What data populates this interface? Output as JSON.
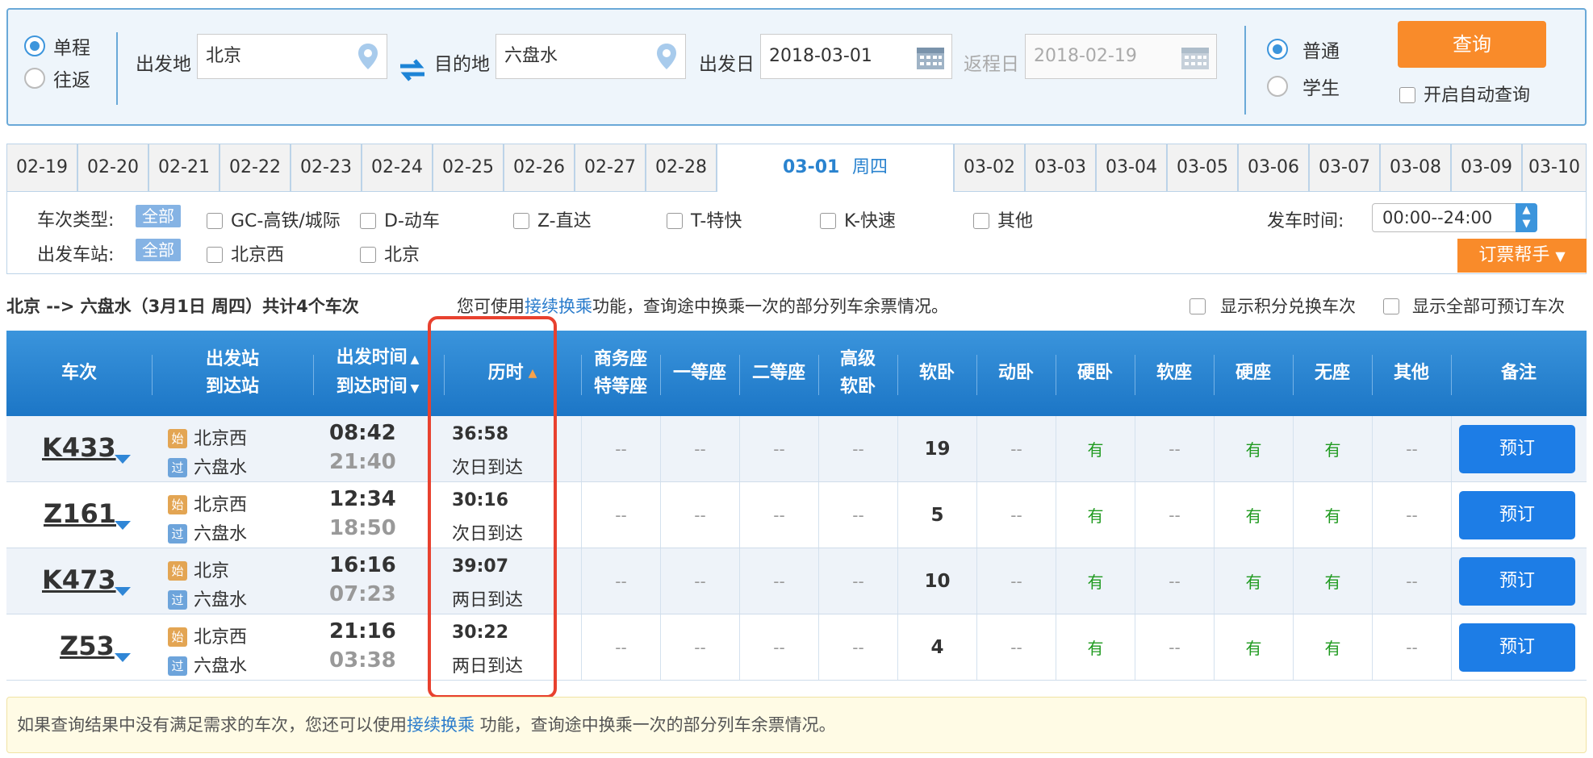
{
  "search": {
    "trip_types": [
      "单程",
      "往返"
    ],
    "trip_selected": "单程",
    "from_label": "出发地",
    "from_value": "北京",
    "to_label": "目的地",
    "to_value": "六盘水",
    "depart_label": "出发日",
    "depart_value": "2018-03-01",
    "return_label": "返程日",
    "return_value": "2018-02-19",
    "passenger_types": [
      "普通",
      "学生"
    ],
    "passenger_selected": "普通",
    "query_button": "查询",
    "auto_query_label": "开启自动查询",
    "icons": [
      "location-pin-icon",
      "swap-icon",
      "calendar-icon"
    ]
  },
  "date_tabs": [
    "02-19",
    "02-20",
    "02-21",
    "02-22",
    "02-23",
    "02-24",
    "02-25",
    "02-26",
    "02-27",
    "02-28",
    "03-01",
    "03-02",
    "03-03",
    "03-04",
    "03-05",
    "03-06",
    "03-07",
    "03-08",
    "03-09",
    "03-10"
  ],
  "active_tab": {
    "date": "03-01",
    "weekday": "周四"
  },
  "filters": {
    "type_label": "车次类型:",
    "all_label": "全部",
    "types": [
      "GC-高铁/城际",
      "D-动车",
      "Z-直达",
      "T-特快",
      "K-快速",
      "其他"
    ],
    "station_label": "出发车站:",
    "stations": [
      "北京西",
      "北京"
    ],
    "time_label": "发车时间:",
    "time_value": "00:00--24:00",
    "helper_button": "订票帮手"
  },
  "summary": {
    "route": "北京 --> 六盘水（3月1日  周四）共计4个车次",
    "transfer_prefix": "您可使用",
    "transfer_link": "接续换乘",
    "transfer_suffix": "功能，查询途中换乘一次的部分列车余票情况。",
    "points_option": "显示积分兑换车次",
    "all_bookable_option": "显示全部可预订车次"
  },
  "table": {
    "headers": {
      "train": "车次",
      "stations_1": "出发站",
      "stations_2": "到达站",
      "times_1": "出发时间",
      "times_2": "到达时间",
      "duration": "历时",
      "business_1": "商务座",
      "business_2": "特等座",
      "first": "一等座",
      "second": "二等座",
      "deluxe_1": "高级",
      "deluxe_2": "软卧",
      "soft_sleeper": "软卧",
      "emu_sleeper": "动卧",
      "hard_sleeper": "硬卧",
      "soft_seat": "软座",
      "hard_seat": "硬座",
      "no_seat": "无座",
      "other": "其他",
      "remark": "备注"
    },
    "start_badge": "始",
    "pass_badge": "过",
    "dash": "--",
    "rows": [
      {
        "train": "K433",
        "from": "北京西",
        "to": "六盘水",
        "dep": "08:42",
        "arr": "21:40",
        "dur": "36:58",
        "arrive": "次日到达",
        "business": "--",
        "first": "--",
        "second": "--",
        "deluxe": "--",
        "soft_sleeper": "19",
        "emu_sleeper": "--",
        "hard_sleeper": "有",
        "soft_seat": "--",
        "hard_seat": "有",
        "no_seat": "有",
        "other": "--",
        "book": "预订"
      },
      {
        "train": "Z161",
        "from": "北京西",
        "to": "六盘水",
        "dep": "12:34",
        "arr": "18:50",
        "dur": "30:16",
        "arrive": "次日到达",
        "business": "--",
        "first": "--",
        "second": "--",
        "deluxe": "--",
        "soft_sleeper": "5",
        "emu_sleeper": "--",
        "hard_sleeper": "有",
        "soft_seat": "--",
        "hard_seat": "有",
        "no_seat": "有",
        "other": "--",
        "book": "预订"
      },
      {
        "train": "K473",
        "from": "北京",
        "to": "六盘水",
        "dep": "16:16",
        "arr": "07:23",
        "dur": "39:07",
        "arrive": "两日到达",
        "business": "--",
        "first": "--",
        "second": "--",
        "deluxe": "--",
        "soft_sleeper": "10",
        "emu_sleeper": "--",
        "hard_sleeper": "有",
        "soft_seat": "--",
        "hard_seat": "有",
        "no_seat": "有",
        "other": "--",
        "book": "预订"
      },
      {
        "train": "Z53",
        "from": "北京西",
        "to": "六盘水",
        "dep": "21:16",
        "arr": "03:38",
        "dur": "30:22",
        "arrive": "两日到达",
        "business": "--",
        "first": "--",
        "second": "--",
        "deluxe": "--",
        "soft_sleeper": "4",
        "emu_sleeper": "--",
        "hard_sleeper": "有",
        "soft_seat": "--",
        "hard_seat": "有",
        "no_seat": "有",
        "other": "--",
        "book": "预订"
      }
    ]
  },
  "notice": {
    "prefix": "如果查询结果中没有满足需求的车次，您还可以使用",
    "link": "接续换乘",
    "suffix": " 功能，查询途中换乘一次的部分列车余票情况。"
  },
  "colors": {
    "accent": "#1d7de6",
    "orange": "#f98b2a",
    "highlight": "#e8412f",
    "available": "#1f9a1f"
  }
}
